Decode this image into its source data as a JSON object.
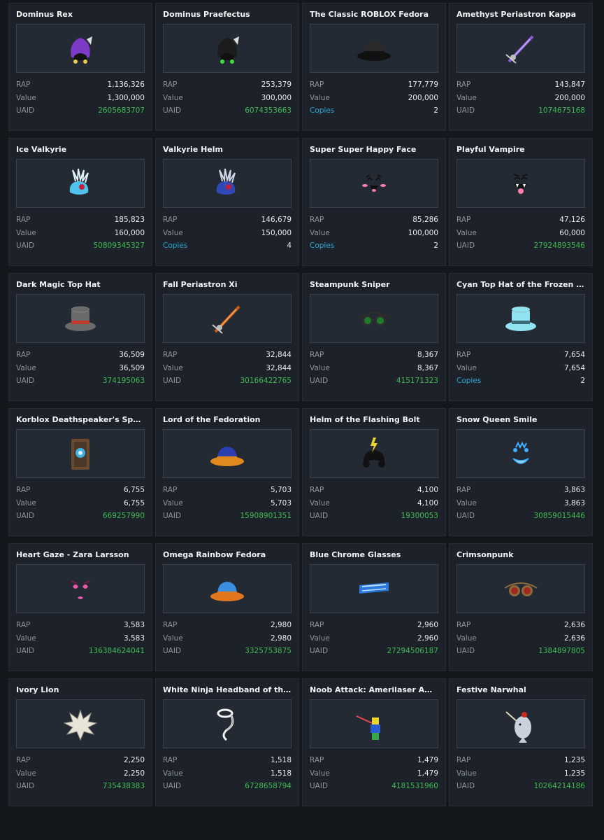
{
  "labels": {
    "rap": "RAP",
    "value": "Value",
    "uaid": "UAID",
    "copies": "Copies"
  },
  "items": [
    {
      "name": "Dominus Rex",
      "rap": "1,136,326",
      "value": "1,300,000",
      "kind": "uaid",
      "third": "2605683707",
      "icon": "dominus-hood-icon",
      "colors": [
        "#7c3ac7",
        "#e8c84a"
      ]
    },
    {
      "name": "Dominus Praefectus",
      "rap": "253,379",
      "value": "300,000",
      "kind": "uaid",
      "third": "6074353663",
      "icon": "dominus-hood-icon",
      "colors": [
        "#1c1c1c",
        "#3fdc3f"
      ]
    },
    {
      "name": "The Classic ROBLOX Fedora",
      "rap": "177,779",
      "value": "200,000",
      "kind": "copies",
      "third": "2",
      "icon": "fedora-icon",
      "colors": [
        "#2a2a2a",
        "#111111"
      ]
    },
    {
      "name": "Amethyst Periastron Kappa",
      "rap": "143,847",
      "value": "200,000",
      "kind": "uaid",
      "third": "1074675168",
      "icon": "sword-icon",
      "colors": [
        "#8a5cd6",
        "#c9b6f0"
      ]
    },
    {
      "name": "Ice Valkyrie",
      "rap": "185,823",
      "value": "160,000",
      "kind": "uaid",
      "third": "50809345327",
      "icon": "valkyrie-helm-icon",
      "colors": [
        "#4fc3ee",
        "#e0f4ff"
      ]
    },
    {
      "name": "Valkyrie Helm",
      "rap": "146,679",
      "value": "150,000",
      "kind": "copies",
      "third": "4",
      "icon": "valkyrie-helm-icon",
      "colors": [
        "#2f48b8",
        "#cfd6e6"
      ]
    },
    {
      "name": "Super Super Happy Face",
      "rap": "85,286",
      "value": "100,000",
      "kind": "copies",
      "third": "2",
      "icon": "happy-face-icon",
      "colors": [
        "#111111",
        "#ff7fb0"
      ]
    },
    {
      "name": "Playful Vampire",
      "rap": "47,126",
      "value": "60,000",
      "kind": "uaid",
      "third": "27924893546",
      "icon": "vampire-face-icon",
      "colors": [
        "#111111",
        "#ff7fb0"
      ]
    },
    {
      "name": "Dark Magic Top Hat",
      "rap": "36,509",
      "value": "36,509",
      "kind": "uaid",
      "third": "374195063",
      "icon": "top-hat-icon",
      "colors": [
        "#6a6a6a",
        "#c0392b"
      ]
    },
    {
      "name": "Fall Periastron Xi",
      "rap": "32,844",
      "value": "32,844",
      "kind": "uaid",
      "third": "30166422765",
      "icon": "sword-icon",
      "colors": [
        "#d05a1e",
        "#f3b15a"
      ]
    },
    {
      "name": "Steampunk Sniper",
      "rap": "8,367",
      "value": "8,367",
      "kind": "uaid",
      "third": "415171323",
      "icon": "goggles-icon",
      "colors": [
        "#1f7a2a",
        "#2e2e2e"
      ]
    },
    {
      "name": "Cyan Top Hat of the Frozen North",
      "rap": "7,654",
      "value": "7,654",
      "kind": "copies",
      "third": "2",
      "icon": "top-hat-icon",
      "colors": [
        "#8fe3f0",
        "#3a6b7a"
      ]
    },
    {
      "name": "Korblox Deathspeaker's Spell Book",
      "rap": "6,755",
      "value": "6,755",
      "kind": "uaid",
      "third": "669257990",
      "icon": "spell-book-icon",
      "colors": [
        "#6b4a2e",
        "#3fb0e0"
      ]
    },
    {
      "name": "Lord of the Fedoration",
      "rap": "5,703",
      "value": "5,703",
      "kind": "uaid",
      "third": "15908901351",
      "icon": "fedora-icon",
      "colors": [
        "#2a3fb0",
        "#e08a1e"
      ]
    },
    {
      "name": "Helm of the Flashing Bolt",
      "rap": "4,100",
      "value": "4,100",
      "kind": "uaid",
      "third": "19300053",
      "icon": "bolt-helm-icon",
      "colors": [
        "#111111",
        "#e8d42a"
      ]
    },
    {
      "name": "Snow Queen Smile",
      "rap": "3,863",
      "value": "3,863",
      "kind": "uaid",
      "third": "30859015446",
      "icon": "smile-face-icon",
      "colors": [
        "#3fb0ff",
        "#9ad8ff"
      ]
    },
    {
      "name": "Heart Gaze - Zara Larsson",
      "rap": "3,583",
      "value": "3,583",
      "kind": "uaid",
      "third": "136384624041",
      "icon": "heart-face-icon",
      "colors": [
        "#e85aa8",
        "#7a1e4a"
      ]
    },
    {
      "name": "Omega Rainbow Fedora",
      "rap": "2,980",
      "value": "2,980",
      "kind": "uaid",
      "third": "3325753875",
      "icon": "fedora-icon",
      "colors": [
        "#3a8fe0",
        "#e0761e"
      ]
    },
    {
      "name": "Blue Chrome Glasses",
      "rap": "2,960",
      "value": "2,960",
      "kind": "uaid",
      "third": "27294506187",
      "icon": "glasses-icon",
      "colors": [
        "#2a7ae0",
        "#bfe0ff"
      ]
    },
    {
      "name": "Crimsonpunk",
      "rap": "2,636",
      "value": "2,636",
      "kind": "uaid",
      "third": "1384897805",
      "icon": "goggles-icon",
      "colors": [
        "#a0281e",
        "#8a6a3a"
      ]
    },
    {
      "name": "Ivory Lion",
      "rap": "2,250",
      "value": "2,250",
      "kind": "uaid",
      "third": "735438383",
      "icon": "lion-mane-icon",
      "colors": [
        "#e8e4d8",
        "#9a968a"
      ]
    },
    {
      "name": "White Ninja Headband of the Unity",
      "rap": "1,518",
      "value": "1,518",
      "kind": "uaid",
      "third": "6728658794",
      "icon": "headband-icon",
      "colors": [
        "#f2f2f2",
        "#9a9a9a"
      ]
    },
    {
      "name": "Noob Attack: Amerilaser Ambush",
      "rap": "1,479",
      "value": "1,479",
      "kind": "uaid",
      "third": "4181531960",
      "icon": "noob-figure-icon",
      "colors": [
        "#e8d42a",
        "#2a5ad0"
      ]
    },
    {
      "name": "Festive Narwhal",
      "rap": "1,235",
      "value": "1,235",
      "kind": "uaid",
      "third": "10264214186",
      "icon": "narwhal-icon",
      "colors": [
        "#c9d2dc",
        "#d0281e"
      ]
    }
  ],
  "colors": {
    "background": "#14171c",
    "card": "#1d222a",
    "thumb": "#242a33",
    "uaid": "#3fb950",
    "copies": "#2aa7d0"
  }
}
